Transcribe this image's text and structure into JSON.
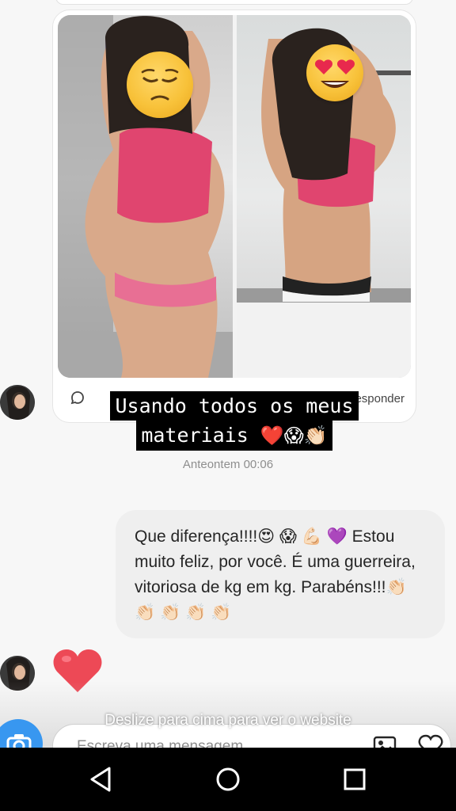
{
  "story_reply": {
    "caption_line1": "Usando todos os meus",
    "caption_line2": "materiais",
    "caption_emojis": "❤️😱👏🏻",
    "footer_text": "Responder"
  },
  "messages": [
    {
      "timestamp": "Anteontem 00:06"
    },
    {
      "text": "Que diferença!!!!😍 😱 💪🏻 💜 Estou muito feliz, por você. É uma guerreira, vitoriosa de kg em kg. Parabéns!!!👏🏻 👏🏻 👏🏻 👏🏻 👏🏻"
    }
  ],
  "composer": {
    "placeholder": "Escreva uma mensagem...",
    "swipe_hint": "Deslize para cima para ver o website"
  },
  "icons": {
    "emoji_left": "pensive-face-emoji",
    "emoji_right": "heart-eyes-emoji",
    "reaction": "red-heart-icon",
    "camera": "camera-icon",
    "gallery": "image-gallery-icon",
    "like": "heart-outline-icon",
    "nav_back": "back-triangle-icon",
    "nav_home": "home-circle-icon",
    "nav_recents": "recents-square-icon"
  },
  "colors": {
    "accent": "#3897f0",
    "bubble": "#efefef",
    "heart": "#ed4956",
    "caption_bg": "#000000"
  }
}
